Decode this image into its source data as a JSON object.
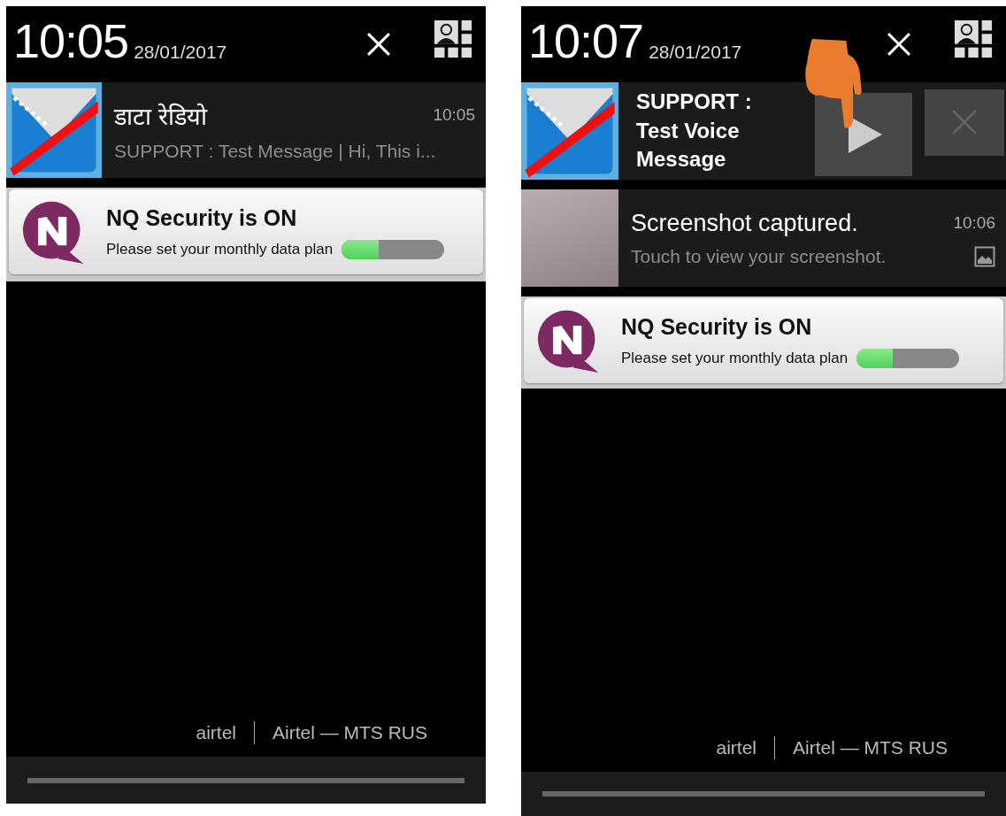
{
  "screens": [
    {
      "time": "10:05",
      "date": "28/01/2017",
      "pointer_hand": false,
      "notifications": [
        {
          "kind": "message",
          "title": "डाटा रेडियो",
          "time": "10:05",
          "text": "SUPPORT : Test Message | Hi, This i..."
        },
        {
          "kind": "nq",
          "title": "NQ Security is ON",
          "text": "Please set your monthly data plan",
          "level": 0.36
        }
      ],
      "carriers": [
        "airtel",
        "Airtel — MTS RUS"
      ]
    },
    {
      "time": "10:07",
      "date": "28/01/2017",
      "pointer_hand": true,
      "notifications": [
        {
          "kind": "voice",
          "title": "SUPPORT : Test Voice Message"
        },
        {
          "kind": "screenshot",
          "title": "Screenshot captured.",
          "time": "10:06",
          "text": "Touch to view your screenshot."
        },
        {
          "kind": "nq",
          "title": "NQ Security is ON",
          "text": "Please set your monthly data plan",
          "level": 0.35
        }
      ],
      "carriers": [
        "airtel",
        "Airtel — MTS RUS"
      ]
    }
  ]
}
